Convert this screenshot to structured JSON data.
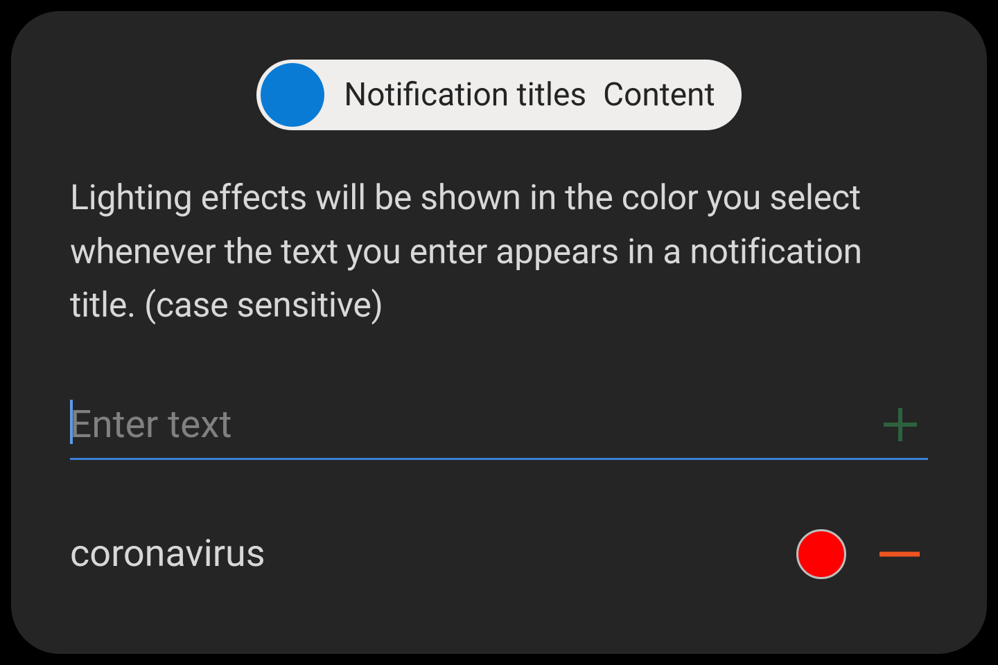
{
  "toggle": {
    "left_label": "Notification titles",
    "right_label": "Content",
    "active": "left",
    "knob_color": "#0a7bd4"
  },
  "description": "Lighting effects will be shown in the color you select whenever the text you enter appears in a notification title. (case sensitive)",
  "input": {
    "placeholder": "Enter text",
    "value": "",
    "underline_color": "#3981d9",
    "add_icon_color": "#2d623e"
  },
  "keywords": [
    {
      "text": "coronavirus",
      "color": "#ff0000",
      "remove_icon_color": "#ee5420"
    }
  ]
}
